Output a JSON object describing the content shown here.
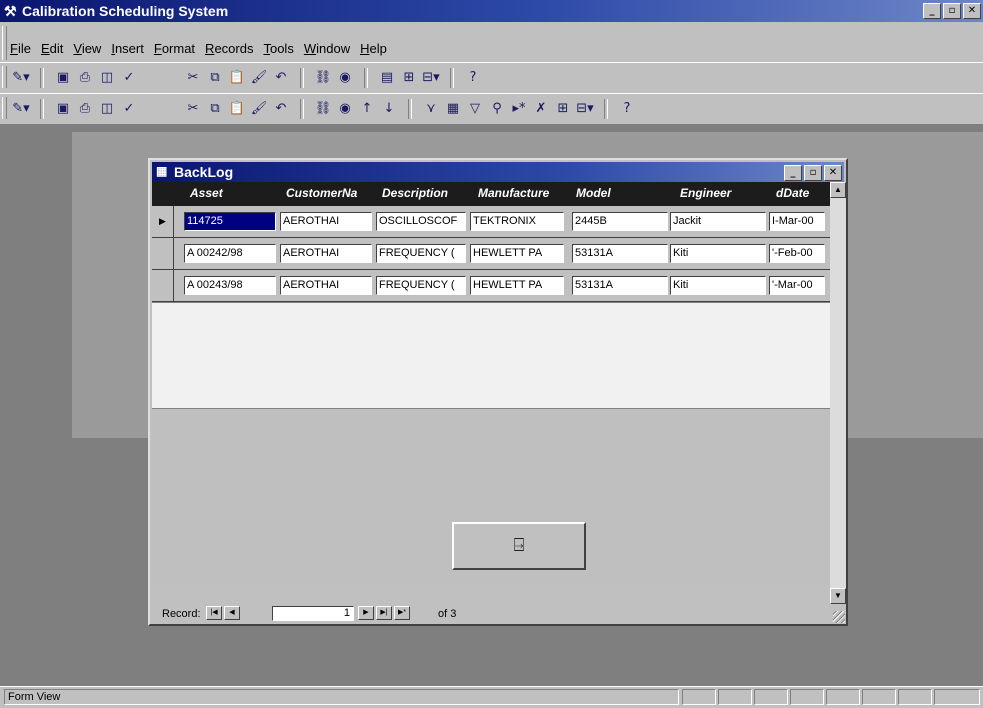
{
  "app": {
    "title": "Calibration Scheduling System",
    "minimize": "_",
    "maximize": "▫",
    "close": "✕"
  },
  "menu": [
    "File",
    "Edit",
    "View",
    "Insert",
    "Format",
    "Records",
    "Tools",
    "Window",
    "Help"
  ],
  "toolbars": [
    [
      "design-view",
      "save",
      "print",
      "print-preview",
      "spelling",
      "cut",
      "copy",
      "paste",
      "format-painter",
      "undo",
      "insert-hyperlink",
      "web-toolbar",
      "properties",
      "database-window",
      "new-object",
      "help"
    ],
    [
      "view",
      "save",
      "print",
      "print-preview",
      "spelling",
      "cut",
      "copy",
      "paste",
      "format-painter",
      "undo",
      "insert-hyperlink",
      "web-toolbar",
      "sort-ascending",
      "sort-descending",
      "filter-by-selection",
      "filter-by-form",
      "apply-filter",
      "find",
      "new-record",
      "delete-record",
      "database-window",
      "new-object",
      "help"
    ]
  ],
  "form": {
    "title": "BackLog",
    "columns": [
      "Asset",
      "CustomerNa",
      "Description",
      "Manufacture",
      "Model",
      "Engineer",
      "dDate"
    ],
    "rows": [
      {
        "asset": "114725",
        "customer": "AEROTHAI",
        "description": "OSCILLOSCOF",
        "manufacturer": "TEKTRONIX",
        "model": "2445B",
        "engineer": "Jackit",
        "date": "I-Mar-00"
      },
      {
        "asset": "A 00242/98",
        "customer": "AEROTHAI",
        "description": "FREQUENCY (",
        "manufacturer": "HEWLETT PA",
        "model": "53131A",
        "engineer": "Kiti",
        "date": "'-Feb-00"
      },
      {
        "asset": "A 00243/98",
        "customer": "AEROTHAI",
        "description": "FREQUENCY (",
        "manufacturer": "HEWLETT PA",
        "model": "53131A",
        "engineer": "Kiti",
        "date": "'-Mar-00"
      }
    ],
    "exit_icon": "exit-door-icon"
  },
  "navigator": {
    "label": "Record:",
    "current": "1",
    "of_text": "of 3"
  },
  "status": {
    "text": "Form View"
  }
}
